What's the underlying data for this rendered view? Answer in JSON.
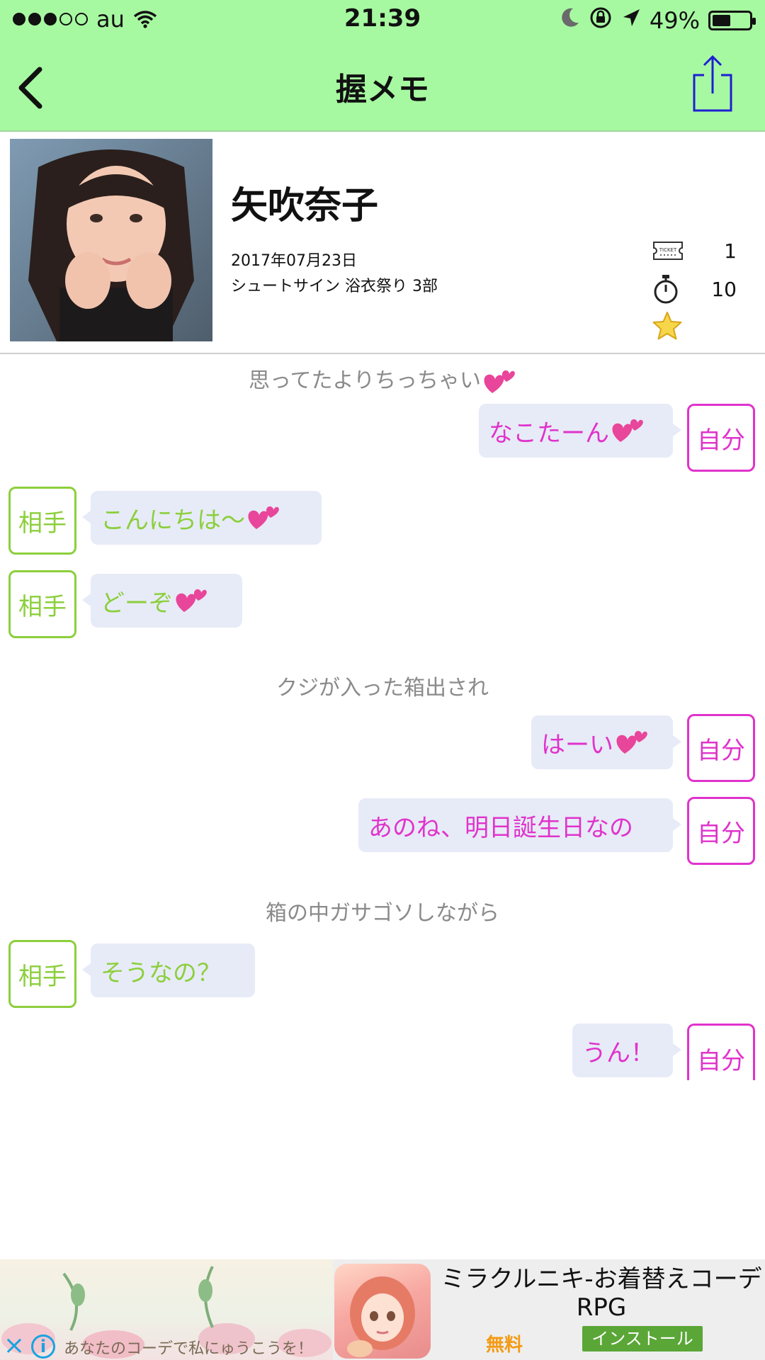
{
  "status_bar": {
    "carrier": "au",
    "time": "21:39",
    "battery_pct": "49%",
    "battery_level": 0.49
  },
  "nav": {
    "title": "握メモ",
    "back_icon": "chevron-left-icon",
    "share_icon": "share-icon"
  },
  "profile": {
    "name": "矢吹奈子",
    "date": "2017年07月23日",
    "event": "シュートサイン 浴衣祭り 3部",
    "ticket_count": "1",
    "timer_count": "10",
    "ticket_icon_text": "TICKET"
  },
  "chat": {
    "self_label": "自分",
    "other_label": "相手",
    "items": [
      {
        "kind": "note",
        "text": "思ってたよりちっちゃい"
      },
      {
        "kind": "self",
        "text": "なこたーん"
      },
      {
        "kind": "other",
        "text": "こんにちは〜"
      },
      {
        "kind": "other",
        "text": "どーぞ"
      },
      {
        "kind": "note",
        "text": "クジが入った箱出され"
      },
      {
        "kind": "self",
        "text": "はーい"
      },
      {
        "kind": "self",
        "text": "あのね、明日誕生日なの"
      },
      {
        "kind": "note",
        "text": "箱の中ガサゴソしながら"
      },
      {
        "kind": "other",
        "text": "そうなの？"
      },
      {
        "kind": "self",
        "text": "うん！"
      }
    ]
  },
  "ad": {
    "title": "ミラクルニキ-お着替えコーデRPG",
    "price": "無料",
    "install": "インストール",
    "banner_text": "あなたのコーデで私にゅうこうを！"
  },
  "colors": {
    "nav_bg": "#a7f9a1",
    "self": "#e033cc",
    "other": "#8ccf3c",
    "bubble": "#e7ebf7"
  }
}
